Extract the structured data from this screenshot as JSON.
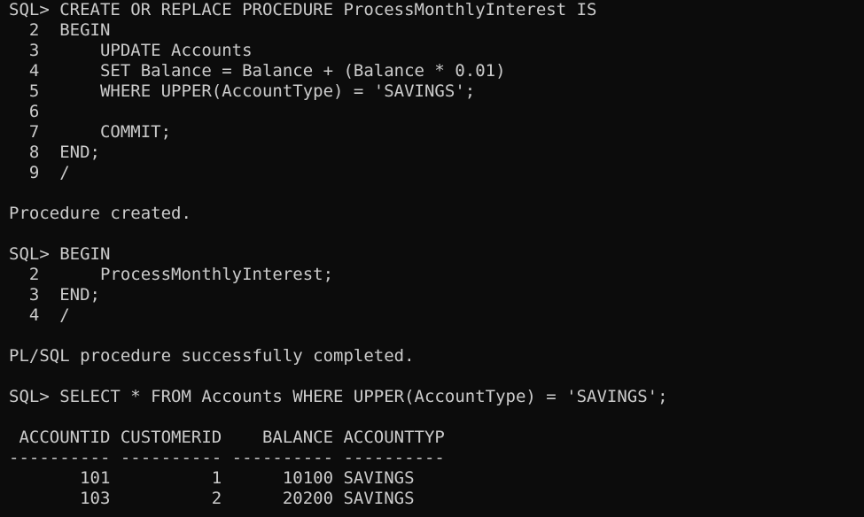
{
  "terminal": {
    "lines": [
      "SQL> CREATE OR REPLACE PROCEDURE ProcessMonthlyInterest IS",
      "  2  BEGIN",
      "  3      UPDATE Accounts",
      "  4      SET Balance = Balance + (Balance * 0.01)",
      "  5      WHERE UPPER(AccountType) = 'SAVINGS';",
      "  6",
      "  7      COMMIT;",
      "  8  END;",
      "  9  /",
      "",
      "Procedure created.",
      "",
      "SQL> BEGIN",
      "  2      ProcessMonthlyInterest;",
      "  3  END;",
      "  4  /",
      "",
      "PL/SQL procedure successfully completed.",
      "",
      "SQL> SELECT * FROM Accounts WHERE UPPER(AccountType) = 'SAVINGS';",
      "",
      " ACCOUNTID CUSTOMERID    BALANCE ACCOUNTTYP",
      "---------- ---------- ---------- ----------",
      "       101          1      10100 SAVINGS",
      "       103          2      20200 SAVINGS"
    ]
  }
}
